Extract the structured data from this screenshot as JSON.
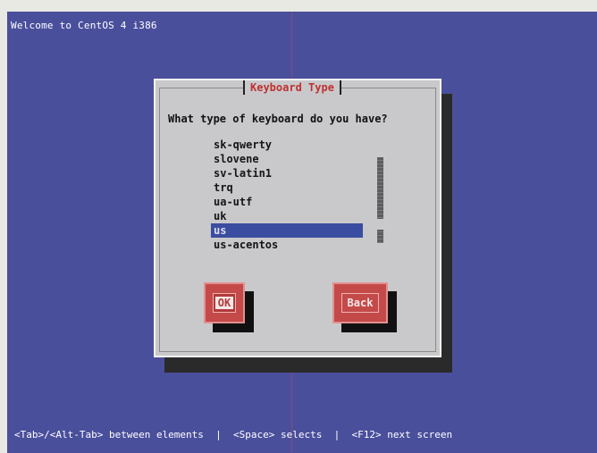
{
  "screen": {
    "welcome_text": "Welcome to CentOS 4 i386",
    "background_color": "#4a4f9c"
  },
  "dialog": {
    "title": "Keyboard Type",
    "question": "What type of keyboard do you have?",
    "items": [
      {
        "label": "sk-qwerty"
      },
      {
        "label": "slovene"
      },
      {
        "label": "sv-latin1"
      },
      {
        "label": "trq"
      },
      {
        "label": "ua-utf"
      },
      {
        "label": "uk"
      },
      {
        "label": "us"
      },
      {
        "label": "us-acentos"
      }
    ],
    "selected_item": "us",
    "scroll_position": 0.82,
    "buttons": {
      "ok_label": "OK",
      "back_label": "Back",
      "focused": "ok"
    }
  },
  "status_bar": {
    "text": "<Tab>/<Alt-Tab> between elements  |  <Space> selects  |  <F12> next screen"
  },
  "colors": {
    "title_red": "#c03030",
    "dialog_bg": "#c9c9cc",
    "selection_blue": "#3a4da0",
    "button_red": "#c44a4a"
  }
}
